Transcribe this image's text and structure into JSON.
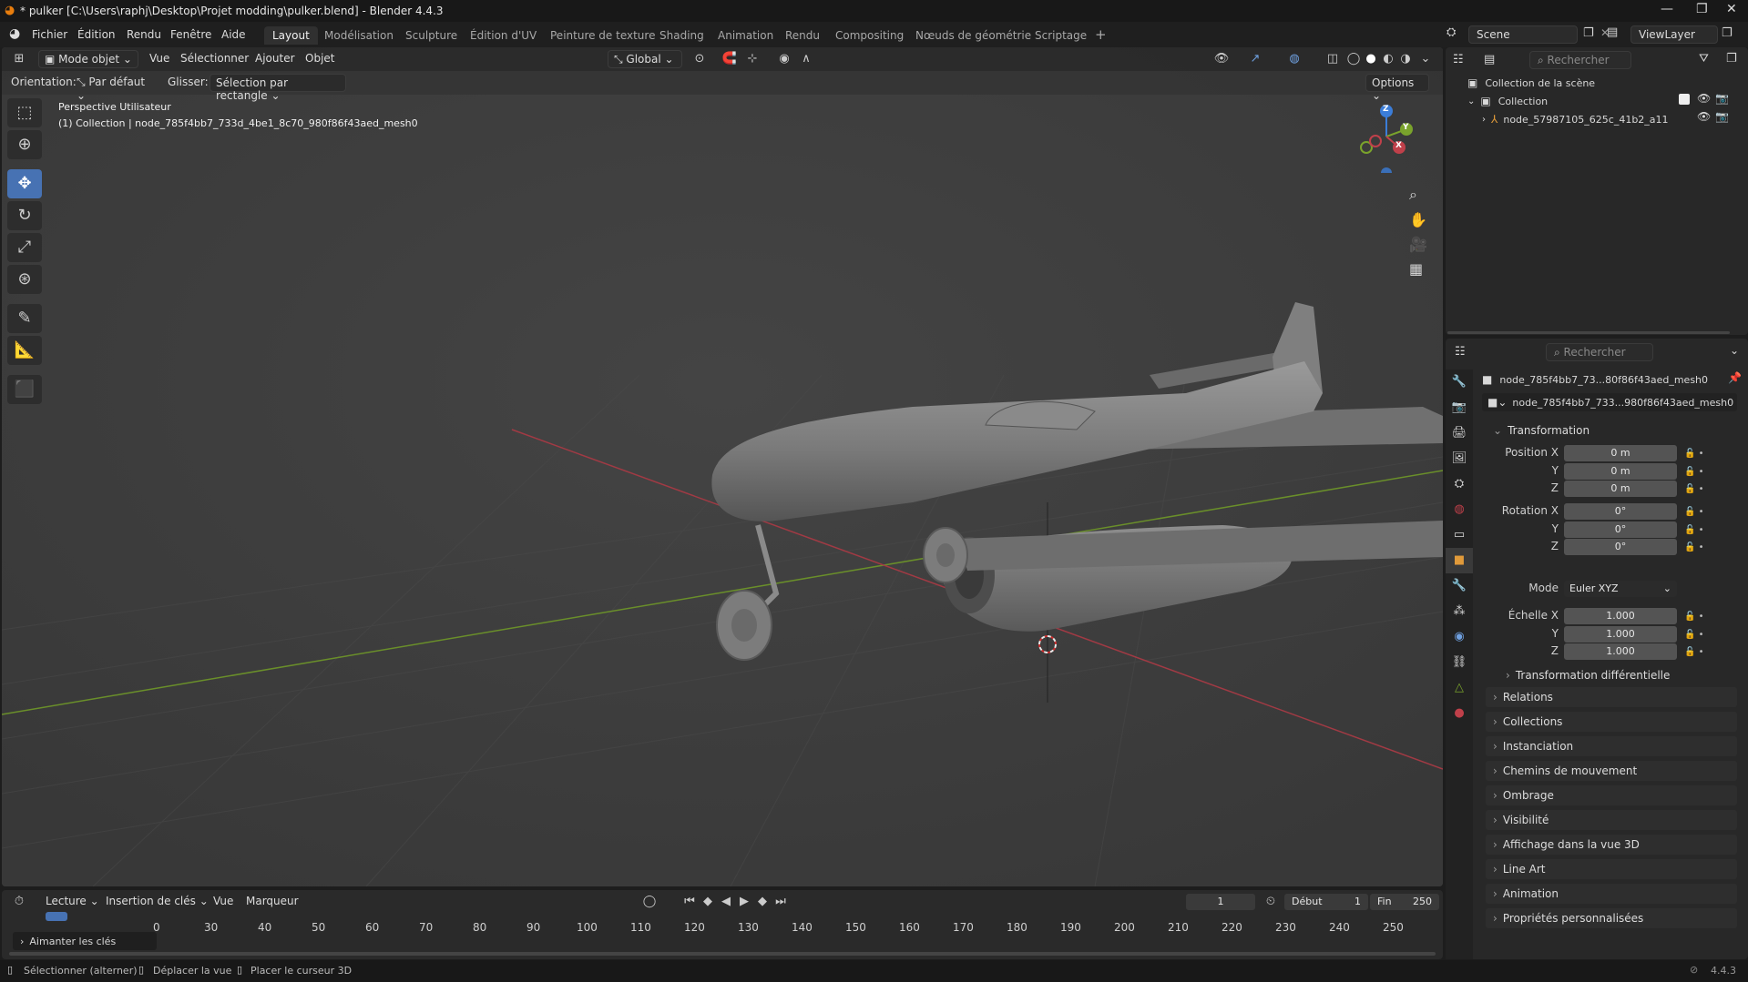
{
  "window": {
    "title": "* pulker [C:\\Users\\raphj\\Desktop\\Projet modding\\pulker.blend] - Blender 4.4.3"
  },
  "menu": [
    "Fichier",
    "Édition",
    "Rendu",
    "Fenêtre",
    "Aide"
  ],
  "workspaces": [
    "Layout",
    "Modélisation",
    "Sculpture",
    "Édition d'UV",
    "Peinture de texture",
    "Shading",
    "Animation",
    "Rendu",
    "Compositing",
    "Nœuds de géométrie",
    "Scriptage"
  ],
  "top_right": {
    "scene": "Scene",
    "view_layer": "ViewLayer"
  },
  "viewport_header": {
    "mode": "Mode objet",
    "menus": [
      "Vue",
      "Sélectionner",
      "Ajouter",
      "Objet"
    ],
    "transform_orientation": "Global"
  },
  "tool_settings": {
    "orientation_label": "Orientation:",
    "orientation_value": "Par défaut",
    "drag_label": "Glisser:",
    "drag_value": "Sélection par rectangle",
    "options": "Options"
  },
  "viewport_info": {
    "line1": "Perspective Utilisateur",
    "line2": "(1) Collection | node_785f4bb7_733d_4be1_8c70_980f86f43aed_mesh0"
  },
  "gizmo": {
    "z": "Z",
    "y": "Y",
    "x": "X"
  },
  "outliner": {
    "search_placeholder": "Rechercher",
    "scene_collection": "Collection de la scène",
    "collection": "Collection",
    "object": "node_57987105_625c_41b2_a11"
  },
  "properties": {
    "search_placeholder": "Rechercher",
    "object_name_top": "node_785f4bb7_73...80f86f43aed_mesh0",
    "object_name_field": "node_785f4bb7_733...980f86f43aed_mesh0",
    "transform_title": "Transformation",
    "position_label": "Position X",
    "rotation_label": "Rotation X",
    "scale_label": "Échelle X",
    "y_label": "Y",
    "z_label": "Z",
    "mode_label": "Mode",
    "position": [
      "0 m",
      "0 m",
      "0 m"
    ],
    "rotation": [
      "0°",
      "0°",
      "0°"
    ],
    "mode": "Euler XYZ",
    "scale": [
      "1.000",
      "1.000",
      "1.000"
    ],
    "delta": "Transformation différentielle",
    "panels": [
      "Relations",
      "Collections",
      "Instanciation",
      "Chemins de mouvement",
      "Ombrage",
      "Visibilité",
      "Affichage dans la vue 3D",
      "Line Art",
      "Animation",
      "Propriétés personnalisées"
    ]
  },
  "timeline": {
    "menus": [
      "Lecture",
      "Insertion de clés",
      "Vue",
      "Marqueur"
    ],
    "current_frame": "1",
    "start_label": "Début",
    "start": "1",
    "end_label": "Fin",
    "end": "250",
    "ticks": [
      "0",
      "30",
      "40",
      "50",
      "60",
      "70",
      "80",
      "90",
      "100",
      "110",
      "120",
      "130",
      "140",
      "150",
      "160",
      "170",
      "180",
      "190",
      "200",
      "210",
      "220",
      "230",
      "240",
      "250"
    ],
    "popup": "Aimanter les clés"
  },
  "statusbar": {
    "select": "Sélectionner (alterner)",
    "move": "Déplacer la vue",
    "cursor": "Placer le curseur 3D",
    "version": "4.4.3"
  },
  "colors": {
    "accent": "#4772b3",
    "x_axis": "#c0404a",
    "y_axis": "#7aa32c",
    "z_axis": "#3b7dd8"
  }
}
